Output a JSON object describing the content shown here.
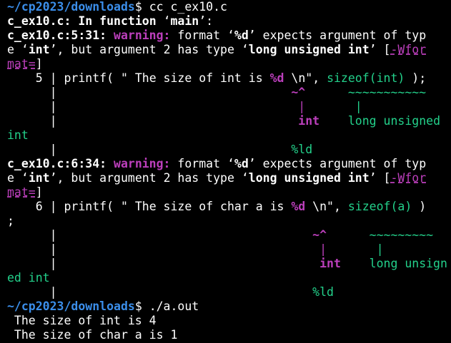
{
  "prompt1": {
    "path": "~/cp2023/downloads",
    "suffix": "$ ",
    "command": "cc c_ex10.c"
  },
  "header": {
    "file": "c_ex10.c",
    "text": ": In function ",
    "q_open": "‘",
    "func": "main",
    "q_close": "’:"
  },
  "warning1": {
    "location": "c_ex10.c:5:31:",
    "label": "warning:",
    "msg_a": " format ",
    "q1_open": "‘",
    "spec": "%d",
    "q1_close": "’",
    "msg_b": " expects argument of typ",
    "wrap_a_open": "e ‘",
    "type1": "int",
    "wrap_a_mid": "’, but argument 2 has type ‘",
    "type2": "long unsigned int",
    "wrap_a_close": "’ [",
    "flag_part1": "-Wfor",
    "flag_part2": "mat=",
    "flag_close": "]",
    "src_lineno": "    5 | ",
    "src_a": "printf( \" The size of int is ",
    "src_spec": "%d",
    "src_b": " \\n\", ",
    "src_arg": "sizeof(int)",
    "src_c": " );",
    "caret_gutter": "      |                                 ",
    "caret_mag": "~^",
    "caret_gap": "      ",
    "caret_grn": "~~~~~~~~~~~",
    "bar_gutter": "      |                                  ",
    "bar_mag": "|",
    "bar_gap": "       ",
    "bar_grn": "|",
    "type_gutter": "      |                                  ",
    "type_mag": "int",
    "type_gap": "    ",
    "type_grn": "long unsigned",
    "wrap_tail": "int",
    "fix_gutter": "      |                                 ",
    "fix": "%ld"
  },
  "warning2": {
    "location": "c_ex10.c:6:34:",
    "label": "warning:",
    "msg_a": " format ",
    "q1_open": "‘",
    "spec": "%d",
    "q1_close": "’",
    "msg_b": " expects argument of typ",
    "wrap_a_open": "e ‘",
    "type1": "int",
    "wrap_a_mid": "’, but argument 2 has type ‘",
    "type2": "long unsigned int",
    "wrap_a_close": "’ [",
    "flag_part1": "-Wfor",
    "flag_part2": "mat=",
    "flag_close": "]",
    "src_lineno": "    6 | ",
    "src_a": "printf( \" The size of char a is ",
    "src_spec": "%d",
    "src_b": " \\n\", ",
    "src_arg": "sizeof(a)",
    "src_c": " )",
    "src_wrap": ";",
    "caret_gutter": "      |                                    ",
    "caret_mag": "~^",
    "caret_gap": "      ",
    "caret_grn": "~~~~~~~~~",
    "bar_gutter": "      |                                     ",
    "bar_mag": "|",
    "bar_gap": "       ",
    "bar_grn": "|",
    "type_gutter": "      |                                     ",
    "type_mag": "int",
    "type_gap": "    ",
    "type_grn": "long unsign",
    "wrap_tail": "ed int",
    "fix_gutter": "      |                                    ",
    "fix": "%ld"
  },
  "prompt2": {
    "path": "~/cp2023/downloads",
    "suffix": "$ ",
    "command": "./a.out"
  },
  "output": [
    " The size of int is 4",
    " The size of char a is 1"
  ],
  "cursor": "_"
}
